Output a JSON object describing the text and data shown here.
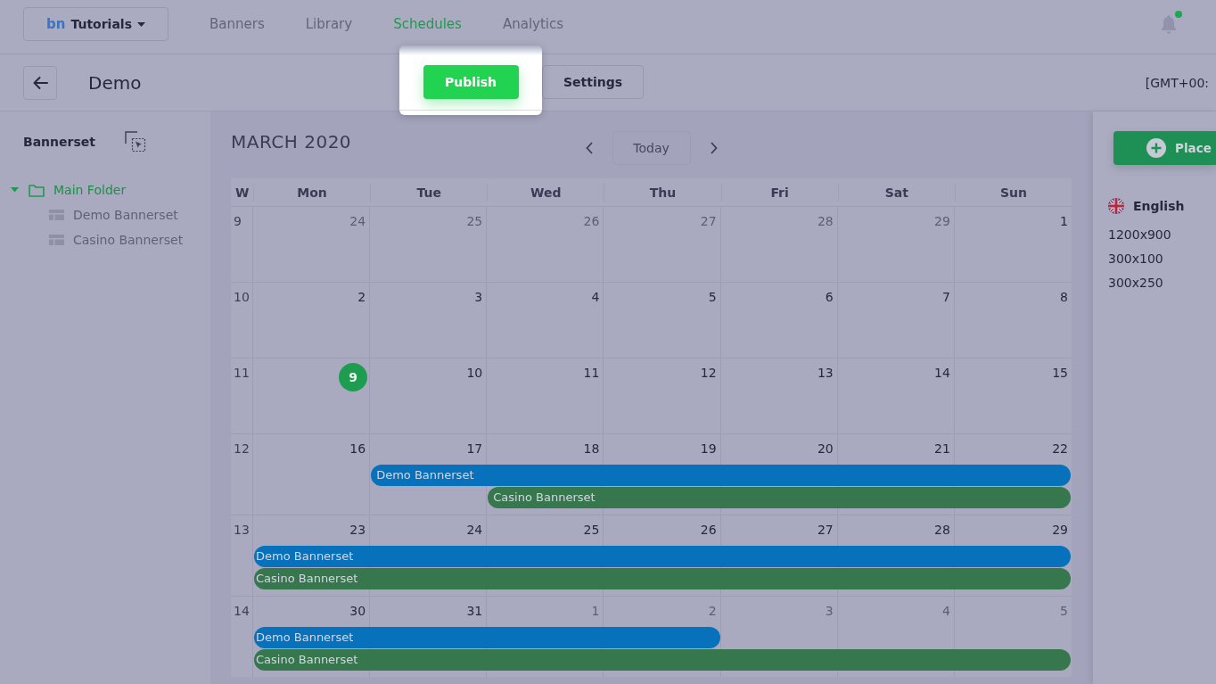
{
  "brand": {
    "logo": "bn",
    "label": "Tutorials"
  },
  "nav_tabs": [
    {
      "label": "Banners",
      "selected": false
    },
    {
      "label": "Library",
      "selected": false
    },
    {
      "label": "Schedules",
      "selected": true
    },
    {
      "label": "Analytics",
      "selected": false
    }
  ],
  "notifications": {
    "unread": true
  },
  "toolbar": {
    "title": "Demo",
    "buttons": [
      {
        "label": "Publish",
        "kind": "primary",
        "highlighted": true
      },
      {
        "label": "Settings",
        "kind": "secondary",
        "highlighted": false
      }
    ],
    "timezone": "[GMT+00:"
  },
  "sidebar": {
    "title": "Bannerset",
    "tree": [
      {
        "label": "Main Folder",
        "kind": "folder",
        "selected": true,
        "expanded": true,
        "children": [
          {
            "label": "Demo Bannerset",
            "kind": "bannerset",
            "selected": false
          },
          {
            "label": "Casino Bannerset",
            "kind": "bannerset",
            "selected": false
          }
        ]
      }
    ]
  },
  "calendar": {
    "title": "MARCH 2020",
    "today_button": "Today",
    "columns": [
      "W",
      "Mon",
      "Tue",
      "Wed",
      "Thu",
      "Fri",
      "Sat",
      "Sun"
    ],
    "weeks": [
      {
        "week": "9",
        "days": [
          {
            "date": "24",
            "in_month": false,
            "today": false
          },
          {
            "date": "25",
            "in_month": false,
            "today": false
          },
          {
            "date": "26",
            "in_month": false,
            "today": false
          },
          {
            "date": "27",
            "in_month": false,
            "today": false
          },
          {
            "date": "28",
            "in_month": false,
            "today": false
          },
          {
            "date": "29",
            "in_month": false,
            "today": false
          },
          {
            "date": "1",
            "in_month": true,
            "today": false
          }
        ]
      },
      {
        "week": "10",
        "days": [
          {
            "date": "2",
            "in_month": true,
            "today": false
          },
          {
            "date": "3",
            "in_month": true,
            "today": false
          },
          {
            "date": "4",
            "in_month": true,
            "today": false
          },
          {
            "date": "5",
            "in_month": true,
            "today": false
          },
          {
            "date": "6",
            "in_month": true,
            "today": false
          },
          {
            "date": "7",
            "in_month": true,
            "today": false
          },
          {
            "date": "8",
            "in_month": true,
            "today": false
          }
        ]
      },
      {
        "week": "11",
        "days": [
          {
            "date": "9",
            "in_month": true,
            "today": true
          },
          {
            "date": "10",
            "in_month": true,
            "today": false
          },
          {
            "date": "11",
            "in_month": true,
            "today": false
          },
          {
            "date": "12",
            "in_month": true,
            "today": false
          },
          {
            "date": "13",
            "in_month": true,
            "today": false
          },
          {
            "date": "14",
            "in_month": true,
            "today": false
          },
          {
            "date": "15",
            "in_month": true,
            "today": false
          }
        ]
      },
      {
        "week": "12",
        "days": [
          {
            "date": "16",
            "in_month": true,
            "today": false
          },
          {
            "date": "17",
            "in_month": true,
            "today": false
          },
          {
            "date": "18",
            "in_month": true,
            "today": false
          },
          {
            "date": "19",
            "in_month": true,
            "today": false
          },
          {
            "date": "20",
            "in_month": true,
            "today": false
          },
          {
            "date": "21",
            "in_month": true,
            "today": false
          },
          {
            "date": "22",
            "in_month": true,
            "today": false
          }
        ],
        "events": [
          {
            "label": "Demo Bannerset",
            "color": "#0772bb",
            "covers": [
              false,
              true,
              true,
              true,
              true,
              true,
              true
            ]
          },
          {
            "label": "Casino Bannerset",
            "color": "#37774d",
            "covers": [
              false,
              false,
              true,
              true,
              true,
              true,
              true
            ]
          }
        ]
      },
      {
        "week": "13",
        "days": [
          {
            "date": "23",
            "in_month": true,
            "today": false
          },
          {
            "date": "24",
            "in_month": true,
            "today": false
          },
          {
            "date": "25",
            "in_month": true,
            "today": false
          },
          {
            "date": "26",
            "in_month": true,
            "today": false
          },
          {
            "date": "27",
            "in_month": true,
            "today": false
          },
          {
            "date": "28",
            "in_month": true,
            "today": false
          },
          {
            "date": "29",
            "in_month": true,
            "today": false
          }
        ],
        "events": [
          {
            "label": "Demo Bannerset",
            "color": "#0772bb",
            "covers": [
              true,
              true,
              true,
              true,
              true,
              true,
              true
            ]
          },
          {
            "label": "Casino Bannerset",
            "color": "#37774d",
            "covers": [
              true,
              true,
              true,
              true,
              true,
              true,
              true
            ]
          }
        ]
      },
      {
        "week": "14",
        "days": [
          {
            "date": "30",
            "in_month": true,
            "today": false
          },
          {
            "date": "31",
            "in_month": true,
            "today": false
          },
          {
            "date": "1",
            "in_month": false,
            "today": false
          },
          {
            "date": "2",
            "in_month": false,
            "today": false
          },
          {
            "date": "3",
            "in_month": false,
            "today": false
          },
          {
            "date": "4",
            "in_month": false,
            "today": false
          },
          {
            "date": "5",
            "in_month": false,
            "today": false
          }
        ],
        "events": [
          {
            "label": "Demo Bannerset",
            "color": "#0772bb",
            "covers": [
              true,
              true,
              true,
              true,
              false,
              false,
              false
            ]
          },
          {
            "label": "Casino Bannerset",
            "color": "#37774d",
            "covers": [
              true,
              true,
              true,
              true,
              true,
              true,
              true
            ]
          }
        ]
      }
    ]
  },
  "right_panel": {
    "add_button": "Place",
    "language": "English",
    "sizes": [
      "1200x900",
      "300x100",
      "300x250"
    ]
  }
}
